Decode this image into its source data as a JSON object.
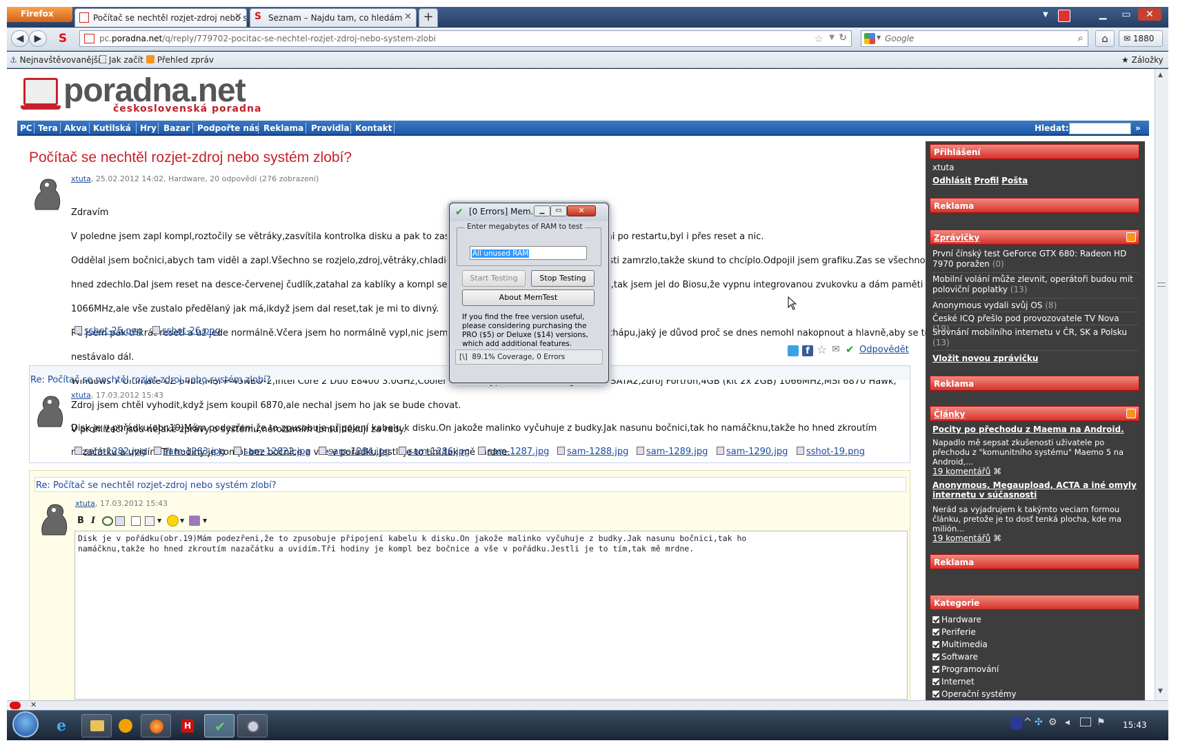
{
  "browser": {
    "menu_button": "Firefox",
    "tabs": [
      {
        "label": "Počítač se nechtěl rozjet-zdroj nebo s..."
      },
      {
        "label": "Seznam – Najdu tam, co hledám"
      }
    ],
    "new_tab": "+",
    "url_prefix": "pc.",
    "url_domain": "poradna.net",
    "url_path": "/q/reply/779702-pocitac-se-nechtel-rozjet-zdroj-nebo-system-zlobi",
    "search_placeholder": "Google",
    "mail_count": "1880",
    "bookmarks": [
      {
        "label": "Nejnavštěvovanější"
      },
      {
        "label": "Jak začít"
      },
      {
        "label": "Přehled zpráv"
      }
    ],
    "bookmarks_right": "Záložky"
  },
  "site": {
    "logo": "poradna.net",
    "logo_sub": "československá poradna",
    "nav": [
      "PC",
      "Tera",
      "Akva",
      "Kutilská",
      "Hry",
      "Bazar",
      "Podpořte nás",
      "Reklama",
      "Pravidla",
      "Kontakt"
    ],
    "search_label": "Hledat:",
    "search_go": "»"
  },
  "question": {
    "title": "Počítač se nechtěl rozjet-zdroj nebo systém zlobí?",
    "author": "xtuta",
    "meta": ", 25.02.2012 14:02, Hardware, 20 odpovědí (276 zobrazení)",
    "body": [
      "Zdravím",
      "V poledne jsem zapl kompl,roztočily se větráky,zasvítila kontrolka disku a pak to zase zhaslo.Počítač se nechtěl rozjet ani po restartu,byl i přes reset a nic.",
      "Oddělal jsem bočnici,abych tam viděl a zapl.Všechno se rozjelo,zdroj,větráky,chladič na CPU,pak to zase v bootovací části zamrzlo,takže skund to chcíplo.Odpojil jsem grafiku.Zas se všechno rozjelo a",
      "hned zdechlo.Dal jsem reset na desce-červenej čudlík,zatahal za kablíky a kompl se pak spustil.Do win jsem se nedostal,tak jsem jel do Biosu,že vypnu integrovanou zvukovku a dám paměti na",
      "1066MHz,ale vše zustalo předělaný jak má,ikdyž jsem dal reset,tak je mi to divný.",
      "PC jsem pak třikrát resetl a už jede normálně.Včera jsem ho normálně vypl,nic jsem neinstaloval ani nic neměnil,tak nechápu,jaký je důvod proč se dnes nemohl nakopnout a hlavně,aby se to",
      "nestávalo dál.",
      "Windows 7 Ultimate CZ 64bit,MSI P-45NEO-2,Intel Core 2 Duo E8400 3.0GHz,Cooler Master Hyper TX3,Samsung 500GB SATA2,zdroj Fortron,4GB (kit 2x 2GB) 1066MHz,MSI 6870 Hawk,",
      "Zdroj jsem chtěl vyhodit,když jsem koupil 6870,ale nechal jsem ho jak se bude chovat.",
      "V prohlížeči jsou nějaké zprávy o systému,nerozumím tomu,děkuji za rady."
    ],
    "attachments": [
      "sshot-25.png",
      "sshot-26.png"
    ],
    "reply": "Odpovědět"
  },
  "reply1": {
    "title": "Re: Počítač se nechtěl rozjet-zdroj nebo systém zlobí?",
    "author": "xtuta",
    "meta": ", 17.03.2012 15:43",
    "body": [
      "Disk je v pořádku(obr.19)Mám podezřeni,že to zpusobuje připojení kabelu k disku.On jakože malinko vyčuhuje z budky.Jak nasunu bočnici,tak ho namáčknu,takže ho hned zkroutím",
      "nazačátku a uvidím.Tři hodiny je kompl bez bočnice a vše v pořádku.Jestli je to tím,tak mě mrdne."
    ],
    "attachments": [
      "sam-1282.jpg",
      "sam-1283.jpg",
      "sam-12822.jpg",
      "sam-1284.jpg",
      "sam-1286.jpg",
      "sam-1287.jpg",
      "sam-1288.jpg",
      "sam-1289.jpg",
      "sam-1290.jpg",
      "sshot-19.png"
    ]
  },
  "editor": {
    "title": "Re: Počítač se  nechtěl rozjet-zdroj nebo systém zlobí?",
    "author": "xtuta",
    "meta": ", 17.03.2012 15:43",
    "text_line1": "Disk je v pořádku(obr.19)Mám podezřeni,že to zpusobuje připojení kabelu k disku.On jakože malinko vyčuhuje z budky.Jak nasunu bočnici,tak ho",
    "text_line2": "namáčknu,takže ho hned zkroutím nazačátku a uvidím.Tři hodiny je kompl bez bočnice a vše v pořádku.Jestli je to tím,tak mě mrdne."
  },
  "sidebar": {
    "login_head": "Přihlášení",
    "login_user": "xtuta",
    "login_links": [
      "Odhlásit",
      "Profil",
      "Pošta"
    ],
    "ad_head": "Reklama",
    "news_head": "Zprávičky",
    "news": [
      {
        "text": "První čínský test GeForce GTX 680: Radeon HD 7970 poražen",
        "count": "0"
      },
      {
        "text": "Mobilní volání může zlevnit, operátoři budou mít poloviční poplatky",
        "count": "13"
      },
      {
        "text": "Anonymous vydali svůj OS",
        "count": "8"
      },
      {
        "text": "České ICQ přešlo pod provozovatele TV Nova",
        "count": "19"
      },
      {
        "text": "Srovnání mobilního internetu v ČR, SK a Polsku",
        "count": "13"
      }
    ],
    "news_add": "Vložit novou zprávičku",
    "articles_head": "Články",
    "articles": [
      {
        "title": "Pocity po přechodu z Maema na Android.",
        "text": "Napadlo mě sepsat zkušenosti uživatele po přechodu z \"komunitního systému\" Maemo 5 na Android,...",
        "comments": "19 komentářů"
      },
      {
        "title": "Anonymous, Megaupload, ACTA a iné omyly internetu v súčasnosti",
        "text": "Nerád sa vyjadrujem k takýmto veciam formou článku, pretože je to dosť tenká plocha, kde ma milión...",
        "comments": "19 komentářů"
      }
    ],
    "cat_head": "Kategorie",
    "categories": [
      "Hardware",
      "Periferie",
      "Multimedia",
      "Software",
      "Programování",
      "Internet",
      "Operační systémy"
    ]
  },
  "dialog": {
    "title": "[0 Errors] Mem...",
    "group_label": "Enter megabytes of RAM to test",
    "input_value": "All unused RAM",
    "start": "Start Testing",
    "stop": "Stop Testing",
    "about": "About MemTest",
    "info": "If you find the free version useful, please considering purchasing the PRO ($5) or Deluxe ($14) versions, which add additional features.",
    "status_prefix": "[\\]",
    "status": "89.1% Coverage, 0 Errors"
  },
  "taskbar": {
    "clock": "15:43"
  }
}
